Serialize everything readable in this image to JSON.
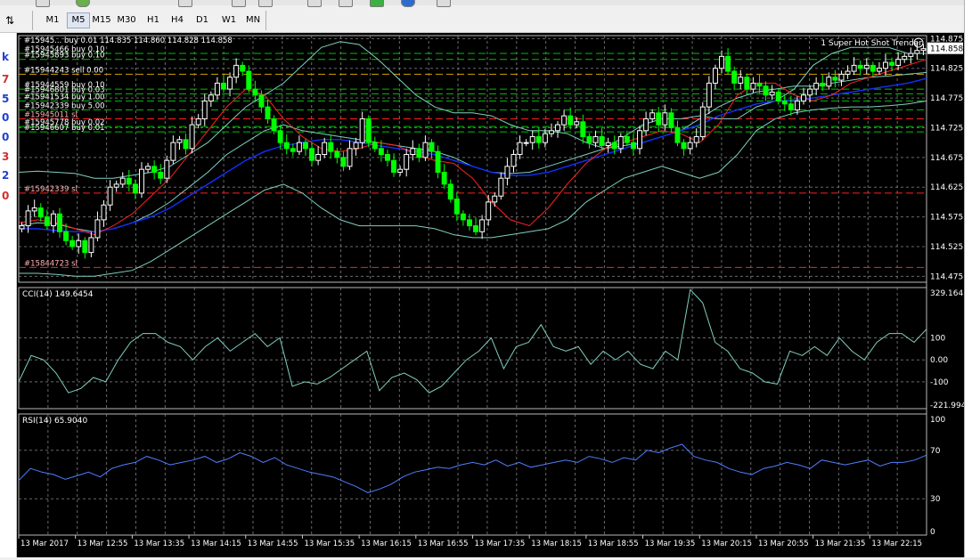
{
  "toolbar": {
    "timeframes": [
      "M1",
      "M5",
      "M15",
      "M30",
      "H1",
      "H4",
      "D1",
      "W1",
      "MN"
    ],
    "active": "M5"
  },
  "left_panel": {
    "values": [
      "k",
      "7",
      "5",
      "0",
      "0",
      "3",
      "2",
      "0"
    ]
  },
  "colors": {
    "background": "#000000",
    "grid": "#8c8c8c",
    "bull_candle": "#ffffff",
    "bear_candle": "#00ff00",
    "bollinger": "#7fcfbf",
    "ma_fast": "#ff2020",
    "ma_slow": "#1030ff",
    "buy_level": "#00c000",
    "sell_level": "#d2a000",
    "sl_level": "#ff2020",
    "cci_line": "#7fcfbf",
    "rsi_line": "#4f7fff"
  },
  "price_panel": {
    "header": "#15945...  buy 0.01  114.835 114.860 114.828 114.858",
    "indicator_label": "1 Super Hot Shot Trender",
    "current_price": "114.858",
    "orders": [
      {
        "label": "#15945466 buy 0.10",
        "price": 114.85,
        "kind": "buy"
      },
      {
        "label": "#15945893 buy 0.10",
        "price": 114.84,
        "kind": "buy"
      },
      {
        "label": "#15944243 sell 0.00",
        "price": 114.815,
        "kind": "sell"
      },
      {
        "label": "#15944559 buy 0.10",
        "price": 114.79,
        "kind": "buy"
      },
      {
        "label": "#15946801 buy 0.03",
        "price": 114.782,
        "kind": "buy"
      },
      {
        "label": "#15941534 buy 1.00",
        "price": 114.77,
        "kind": "buy"
      },
      {
        "label": "#15942339 buy 5.00",
        "price": 114.755,
        "kind": "buy"
      },
      {
        "label": "#15945011 sl",
        "price": 114.74,
        "kind": "sl"
      },
      {
        "label": "#15945778 buy 0.02",
        "price": 114.727,
        "kind": "buy"
      },
      {
        "label": "#15946607 buy 0.01",
        "price": 114.718,
        "kind": "buy"
      },
      {
        "label": "#15942339 sl",
        "price": 114.615,
        "kind": "sl"
      },
      {
        "label": "#15844723 sl",
        "price": 114.49,
        "kind": "sl"
      }
    ]
  },
  "chart_data": [
    {
      "type": "candlestick",
      "title": "",
      "ylim": [
        114.465,
        114.88
      ],
      "y_ticks": [
        "114.875",
        "114.825",
        "114.775",
        "114.725",
        "114.675",
        "114.625",
        "114.575",
        "114.525",
        "114.475"
      ],
      "x_ticks": [
        "13 Mar 2017",
        "13 Mar 12:55",
        "13 Mar 13:35",
        "13 Mar 14:15",
        "13 Mar 14:55",
        "13 Mar 15:35",
        "13 Mar 16:15",
        "13 Mar 16:55",
        "13 Mar 17:35",
        "13 Mar 18:15",
        "13 Mar 18:55",
        "13 Mar 19:35",
        "13 Mar 20:15",
        "13 Mar 20:55",
        "13 Mar 21:35",
        "13 Mar 22:15"
      ],
      "close": [
        114.56,
        114.585,
        114.59,
        114.575,
        114.56,
        114.58,
        114.55,
        114.535,
        114.525,
        114.535,
        114.515,
        114.54,
        114.57,
        114.595,
        114.625,
        114.63,
        114.64,
        114.63,
        114.615,
        114.655,
        114.66,
        114.65,
        114.64,
        114.67,
        114.7,
        114.705,
        114.69,
        114.73,
        114.74,
        114.77,
        114.78,
        114.8,
        114.79,
        114.81,
        114.83,
        114.82,
        114.79,
        114.78,
        114.76,
        114.74,
        114.72,
        114.7,
        114.69,
        114.685,
        114.7,
        114.69,
        114.67,
        114.68,
        114.7,
        114.685,
        114.675,
        114.66,
        114.69,
        114.7,
        114.74,
        114.7,
        114.69,
        114.68,
        114.67,
        114.65,
        114.655,
        114.68,
        114.69,
        114.675,
        114.7,
        114.685,
        114.65,
        114.63,
        114.605,
        114.58,
        114.57,
        114.56,
        114.55,
        114.57,
        114.6,
        114.61,
        114.64,
        114.66,
        114.68,
        114.7,
        114.7,
        114.71,
        114.7,
        114.715,
        114.72,
        114.73,
        114.745,
        114.73,
        114.735,
        114.71,
        114.7,
        114.71,
        114.695,
        114.7,
        114.69,
        114.71,
        114.7,
        114.69,
        114.72,
        114.74,
        114.75,
        114.73,
        114.75,
        114.725,
        114.7,
        114.69,
        114.7,
        114.71,
        114.76,
        114.8,
        114.825,
        114.845,
        114.82,
        114.8,
        114.81,
        114.79,
        114.8,
        114.795,
        114.78,
        114.785,
        114.77,
        114.765,
        114.755,
        114.77,
        114.78,
        114.79,
        114.8,
        114.795,
        114.81,
        114.805,
        114.815,
        114.82,
        114.83,
        114.825,
        114.83,
        114.82,
        114.825,
        114.835,
        114.83,
        114.84,
        114.845,
        114.85,
        114.855,
        114.858
      ],
      "bollinger_upper": [
        114.65,
        114.652,
        114.65,
        114.648,
        114.64,
        114.64,
        114.645,
        114.65,
        114.66,
        114.68,
        114.7,
        114.73,
        114.76,
        114.78,
        114.8,
        114.83,
        114.86,
        114.87,
        114.865,
        114.84,
        114.81,
        114.78,
        114.76,
        114.75,
        114.75,
        114.745,
        114.73,
        114.72,
        114.72,
        114.715,
        114.7,
        114.69,
        114.71,
        114.73,
        114.74,
        114.74,
        114.745,
        114.74,
        114.74,
        114.76,
        114.77,
        114.79,
        114.83,
        114.85,
        114.86,
        114.86,
        114.86,
        114.85,
        114.85
      ],
      "bollinger_mid": [
        114.56,
        114.565,
        114.563,
        114.555,
        114.55,
        114.555,
        114.565,
        114.58,
        114.6,
        114.625,
        114.65,
        114.68,
        114.7,
        114.72,
        114.73,
        114.72,
        114.715,
        114.71,
        114.705,
        114.7,
        114.695,
        114.69,
        114.685,
        114.675,
        114.66,
        114.65,
        114.648,
        114.65,
        114.66,
        114.67,
        114.68,
        114.69,
        114.695,
        114.7,
        114.71,
        114.72,
        114.74,
        114.76,
        114.775,
        114.785,
        114.79,
        114.795,
        114.795,
        114.8,
        114.805,
        114.81,
        114.812,
        114.815,
        114.818
      ],
      "bollinger_lower": [
        114.48,
        114.48,
        114.478,
        114.475,
        114.475,
        114.48,
        114.485,
        114.5,
        114.52,
        114.54,
        114.56,
        114.58,
        114.6,
        114.62,
        114.63,
        114.615,
        114.59,
        114.57,
        114.56,
        114.56,
        114.56,
        114.56,
        114.555,
        114.545,
        114.54,
        114.54,
        114.545,
        114.55,
        114.555,
        114.57,
        114.6,
        114.62,
        114.64,
        114.65,
        114.66,
        114.65,
        114.64,
        114.65,
        114.68,
        114.72,
        114.74,
        114.75,
        114.755,
        114.758,
        114.76,
        114.76,
        114.762,
        114.765,
        114.77
      ],
      "ma_fast": [
        114.565,
        114.57,
        114.565,
        114.555,
        114.545,
        114.56,
        114.58,
        114.61,
        114.64,
        114.68,
        114.72,
        114.76,
        114.79,
        114.78,
        114.74,
        114.71,
        114.69,
        114.685,
        114.69,
        114.7,
        114.695,
        114.68,
        114.67,
        114.665,
        114.64,
        114.6,
        114.57,
        114.56,
        114.59,
        114.63,
        114.665,
        114.69,
        114.7,
        114.71,
        114.72,
        114.715,
        114.7,
        114.73,
        114.78,
        114.8,
        114.8,
        114.78,
        114.77,
        114.78,
        114.8,
        114.81,
        114.82,
        114.83,
        114.84
      ],
      "ma_slow": [
        114.555,
        114.555,
        114.552,
        114.55,
        114.55,
        114.555,
        114.565,
        114.575,
        114.59,
        114.61,
        114.63,
        114.65,
        114.67,
        114.685,
        114.695,
        114.7,
        114.705,
        114.705,
        114.7,
        114.695,
        114.69,
        114.685,
        114.68,
        114.67,
        114.66,
        114.65,
        114.645,
        114.645,
        114.65,
        114.66,
        114.67,
        114.68,
        114.69,
        114.7,
        114.71,
        114.72,
        114.73,
        114.745,
        114.755,
        114.765,
        114.77,
        114.772,
        114.775,
        114.78,
        114.785,
        114.79,
        114.795,
        114.8,
        114.808
      ]
    },
    {
      "type": "line",
      "title": "CCI(14) 149.6454",
      "ylim": [
        -221.9946,
        329.1641
      ],
      "y_ticks": [
        "329.1641",
        "100",
        "0.00",
        "-100",
        "-221.9946"
      ],
      "series": [
        {
          "values": [
            -100,
            20,
            0,
            -60,
            -150,
            -130,
            -80,
            -100,
            0,
            80,
            120,
            120,
            80,
            60,
            0,
            60,
            100,
            40,
            80,
            120,
            60,
            100,
            -120,
            -100,
            -110,
            -80,
            -40,
            0,
            40,
            -140,
            -80,
            -60,
            -90,
            -150,
            -120,
            -60,
            0,
            40,
            100,
            -40,
            60,
            80,
            160,
            60,
            40,
            60,
            -20,
            40,
            0,
            40,
            -20,
            -40,
            40,
            0,
            320,
            260,
            80,
            40,
            -40,
            -60,
            -100,
            -110,
            40,
            20,
            60,
            20,
            100,
            40,
            0,
            80,
            120,
            120,
            80,
            140
          ]
        }
      ]
    },
    {
      "type": "line",
      "title": "RSI(14) 65.9040",
      "ylim": [
        0,
        100
      ],
      "y_ticks": [
        "100",
        "70",
        "30",
        "0"
      ],
      "series": [
        {
          "values": [
            45,
            55,
            52,
            50,
            46,
            49,
            52,
            48,
            55,
            58,
            60,
            65,
            62,
            58,
            60,
            62,
            65,
            60,
            63,
            68,
            65,
            60,
            64,
            58,
            55,
            52,
            50,
            48,
            44,
            40,
            35,
            38,
            42,
            48,
            52,
            54,
            56,
            55,
            58,
            60,
            58,
            62,
            57,
            60,
            56,
            58,
            60,
            62,
            60,
            65,
            63,
            60,
            64,
            62,
            70,
            68,
            72,
            75,
            65,
            62,
            60,
            55,
            52,
            50,
            55,
            57,
            60,
            58,
            55,
            62,
            60,
            58,
            60,
            62,
            57,
            60,
            60,
            62,
            66
          ]
        }
      ]
    }
  ]
}
